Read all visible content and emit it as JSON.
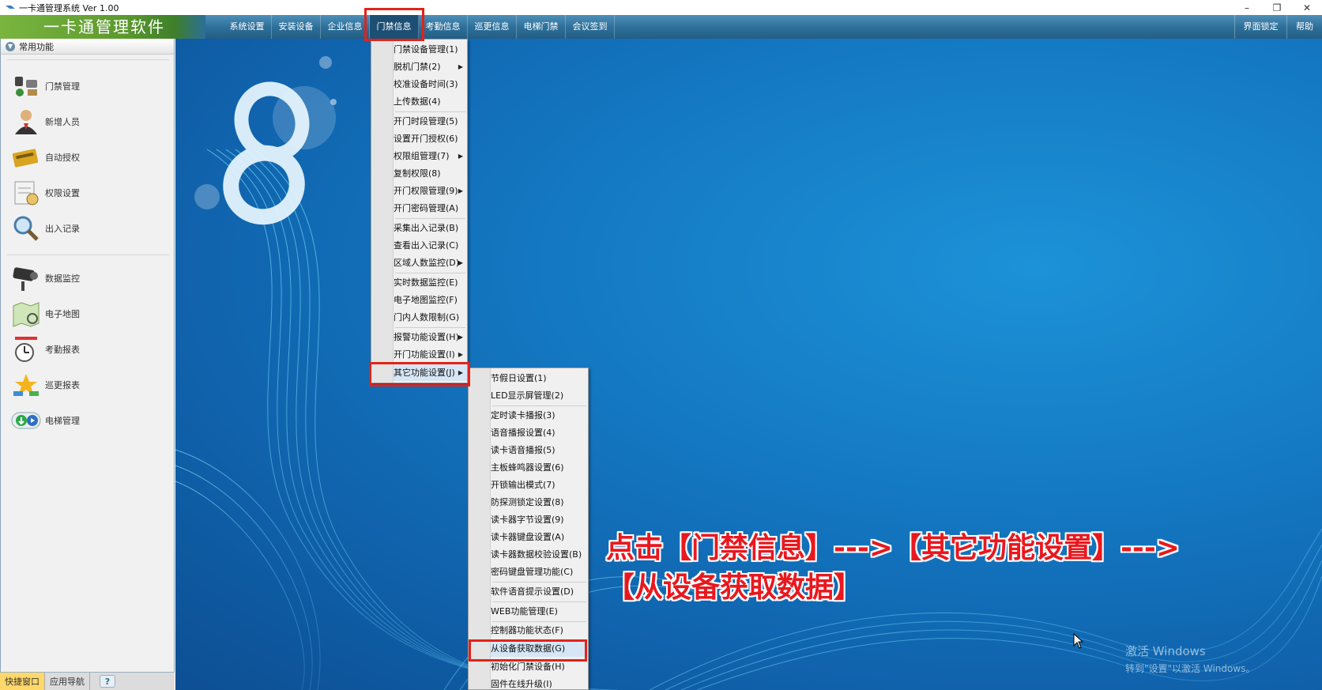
{
  "window": {
    "title": "一卡通管理系统 Ver 1.00",
    "controls": [
      "–",
      "❐",
      "✕"
    ]
  },
  "brand": "一卡通管理软件",
  "menubar": {
    "items": [
      "系统设置",
      "安装设备",
      "企业信息",
      "门禁信息",
      "考勤信息",
      "巡更信息",
      "电梯门禁",
      "会议签到"
    ],
    "active": "门禁信息",
    "right": [
      "界面锁定",
      "帮助"
    ]
  },
  "sidebar": {
    "header": "常用功能",
    "items": [
      {
        "label": "门禁管理",
        "icon": "door-access-icon"
      },
      {
        "label": "新增人员",
        "icon": "person-icon"
      },
      {
        "label": "自动授权",
        "icon": "card-icon"
      },
      {
        "label": "权限设置",
        "icon": "permission-icon"
      },
      {
        "label": "出入记录",
        "icon": "magnifier-icon"
      },
      {
        "label": "数据监控",
        "icon": "camera-icon"
      },
      {
        "label": "电子地图",
        "icon": "map-icon"
      },
      {
        "label": "考勤报表",
        "icon": "clock-icon"
      },
      {
        "label": "巡更报表",
        "icon": "patrol-icon"
      },
      {
        "label": "电梯管理",
        "icon": "elevator-icon"
      }
    ],
    "bottom_tabs": [
      "快捷窗口",
      "应用导航"
    ],
    "help": "?"
  },
  "menu_access": {
    "items": [
      {
        "label": "门禁设备管理(1)",
        "submenu": false
      },
      {
        "label": "脱机门禁(2)",
        "submenu": true
      },
      {
        "label": "校准设备时间(3)",
        "submenu": false
      },
      {
        "label": "上传数据(4)",
        "submenu": false
      },
      {
        "label": "开门时段管理(5)",
        "submenu": false
      },
      {
        "label": "设置开门授权(6)",
        "submenu": false
      },
      {
        "label": "权限组管理(7)",
        "submenu": true
      },
      {
        "label": "复制权限(8)",
        "submenu": false
      },
      {
        "label": "开门权限管理(9)",
        "submenu": true
      },
      {
        "label": "开门密码管理(A)",
        "submenu": false
      },
      {
        "label": "采集出入记录(B)",
        "submenu": false
      },
      {
        "label": "查看出入记录(C)",
        "submenu": false
      },
      {
        "label": "区域人数监控(D)",
        "submenu": true
      },
      {
        "label": "实时数据监控(E)",
        "submenu": false
      },
      {
        "label": "电子地图监控(F)",
        "submenu": false
      },
      {
        "label": "门内人数限制(G)",
        "submenu": false
      },
      {
        "label": "报警功能设置(H)",
        "submenu": true
      },
      {
        "label": "开门功能设置(I)",
        "submenu": true
      },
      {
        "label": "其它功能设置(J)",
        "submenu": true
      }
    ]
  },
  "menu_other": {
    "items": [
      "节假日设置(1)",
      "LED显示屏管理(2)",
      "定时读卡播报(3)",
      "语音播报设置(4)",
      "读卡语音播报(5)",
      "主板蜂鸣器设置(6)",
      "开锁输出模式(7)",
      "防探测锁定设置(8)",
      "读卡器字节设置(9)",
      "读卡器键盘设置(A)",
      "读卡器数据校验设置(B)",
      "密码键盘管理功能(C)",
      "软件语音提示设置(D)",
      "WEB功能管理(E)",
      "控制器功能状态(F)",
      "从设备获取数据(G)",
      "初始化门禁设备(H)",
      "固件在线升级(I)"
    ]
  },
  "annotation": {
    "line1": "点击【门禁信息】--->【其它功能设置】--->",
    "line2": "【从设备获取数据】"
  },
  "watermark": {
    "line1": "激活 Windows",
    "line2": "转到\"设置\"以激活 Windows。"
  },
  "colors": {
    "highlight_box": "#e2231a",
    "menubar": "#2c6e98",
    "brand_green": "#5c9a2e",
    "background_blue": "#1478c2"
  }
}
